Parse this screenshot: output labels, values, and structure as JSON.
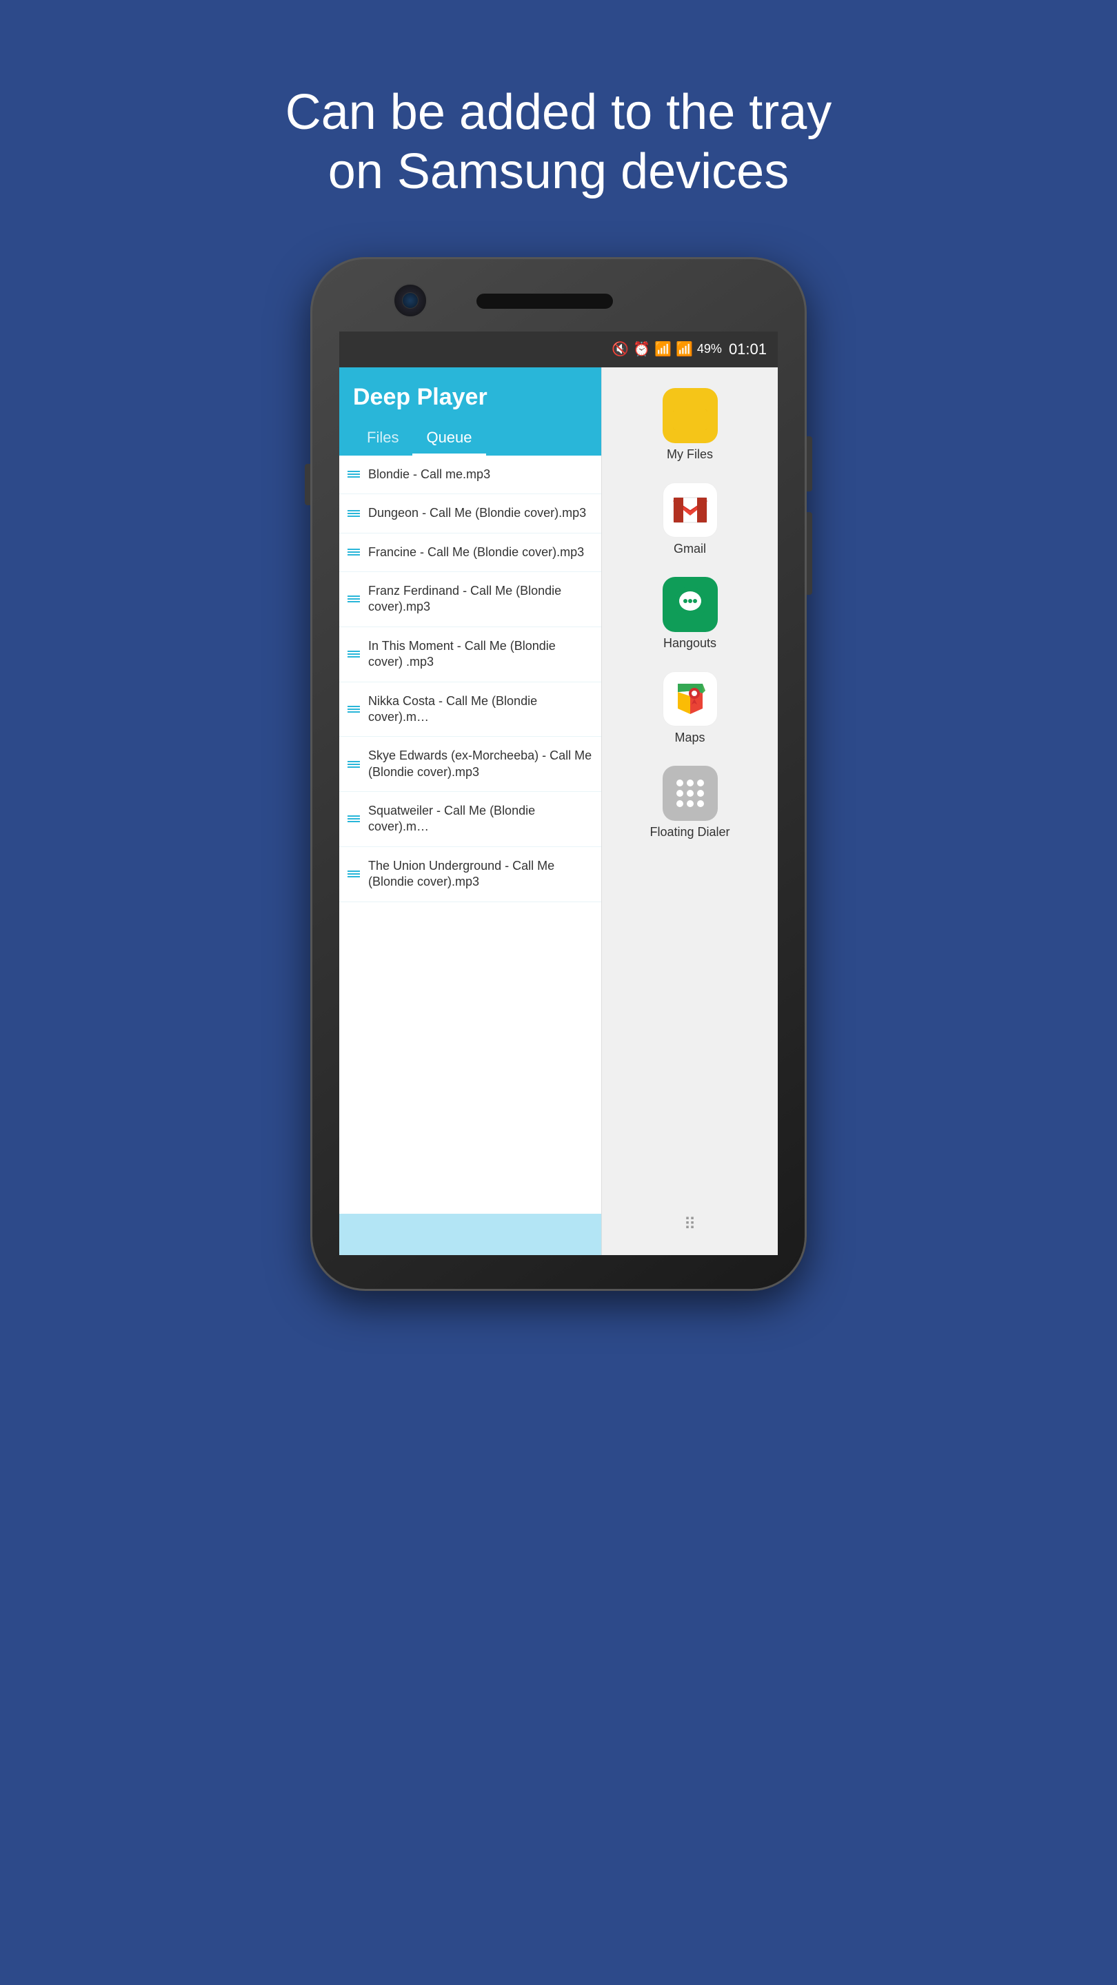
{
  "page": {
    "background_color": "#2d4a8a",
    "headline_line1": "Can be added to the tray",
    "headline_line2": "on Samsung devices"
  },
  "status_bar": {
    "icons": [
      "🔇",
      "⏰",
      "📶",
      "📶"
    ],
    "battery": "49%",
    "time": "01:01"
  },
  "app": {
    "title": "Deep Player",
    "tabs": [
      {
        "label": "Files",
        "active": false
      },
      {
        "label": "Queue",
        "active": true
      }
    ]
  },
  "file_list": {
    "items": [
      {
        "name": "Blondie - Call me.mp3"
      },
      {
        "name": "Dungeon - Call Me (Blondie cover).mp3"
      },
      {
        "name": "Francine - Call Me (Blondie cover).mp3"
      },
      {
        "name": "Franz Ferdinand - Call Me (Blondie cover).mp3"
      },
      {
        "name": "In This Moment - Call Me (Blondie cover) .mp3"
      },
      {
        "name": "Nikka Costa - Call Me (Blondie cover).m…"
      },
      {
        "name": "Skye Edwards (ex-Morcheeba) - Call Me (Blondie cover).mp3"
      },
      {
        "name": "Squatweiler - Call Me (Blondie cover).m…"
      },
      {
        "name": "The Union Underground - Call Me (Blondie cover).mp3"
      }
    ]
  },
  "tray": {
    "items": [
      {
        "id": "my-files",
        "label": "My Files",
        "icon_type": "folder"
      },
      {
        "id": "gmail",
        "label": "Gmail",
        "icon_type": "gmail"
      },
      {
        "id": "hangouts",
        "label": "Hangouts",
        "icon_type": "hangouts"
      },
      {
        "id": "maps",
        "label": "Maps",
        "icon_type": "maps"
      },
      {
        "id": "floating-dialer",
        "label": "Floating Dialer",
        "icon_type": "dialer"
      }
    ]
  }
}
